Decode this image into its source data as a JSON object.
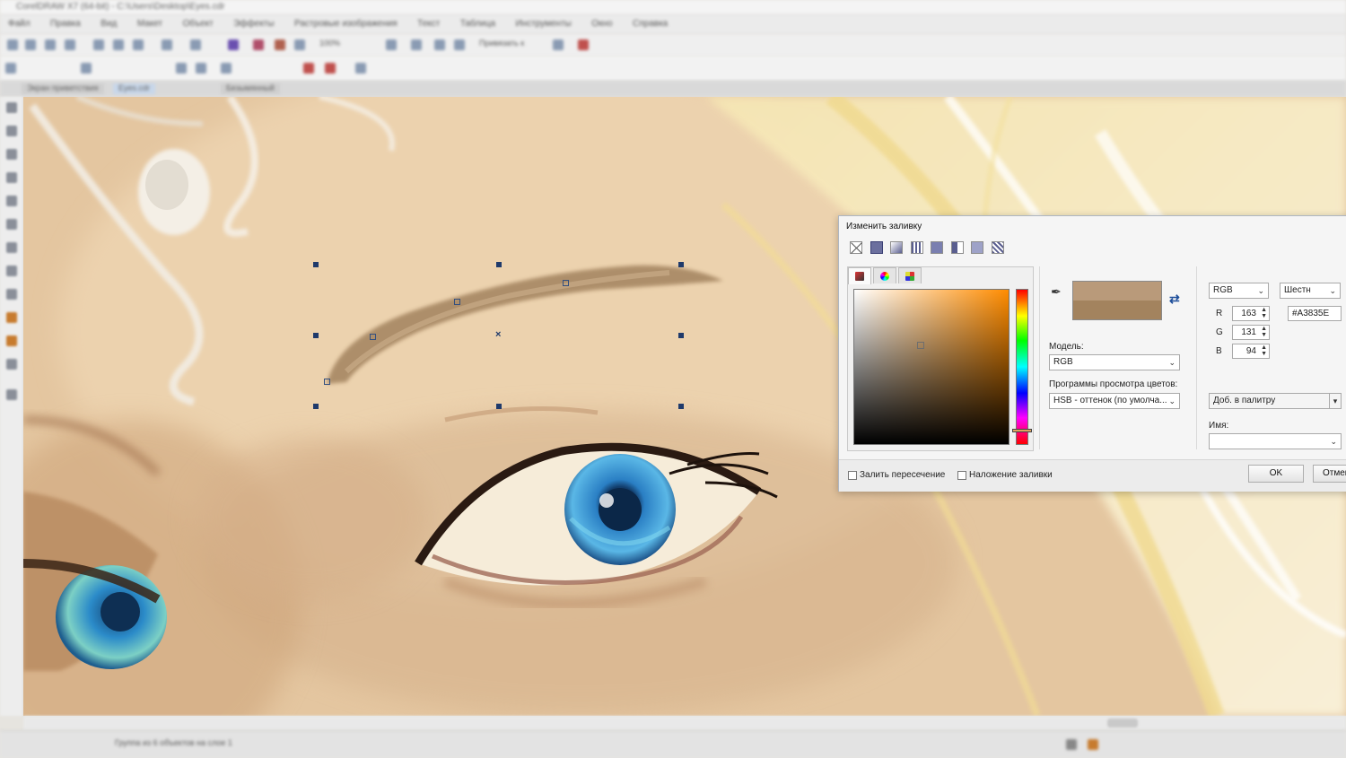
{
  "app": {
    "window_title": "CorelDRAW X7 (64-bit) - C:\\Users\\Desktop\\Eyes.cdr",
    "menu": [
      "Файл",
      "Правка",
      "Вид",
      "Макет",
      "Объект",
      "Эффекты",
      "Растровые изображения",
      "Текст",
      "Таблица",
      "Инструменты",
      "Окно",
      "Справка"
    ],
    "zoom": "100%",
    "snap_label": "Привязать к",
    "tabs": [
      "Экран приветствия",
      "Eyes.cdr",
      "Безымянный"
    ],
    "status_text": "Группа из 6 объектов на слое 1"
  },
  "canvas": {
    "colors": {
      "skin": "#e7c9a2",
      "brow": "#a3835e",
      "iris": "#2a7fc4",
      "hair": "#f3e2a8"
    }
  },
  "dialog": {
    "title": "Изменить заливку",
    "fill_types": [
      "no-fill",
      "uniform-fill",
      "fountain-fill",
      "vector-pattern-fill",
      "bitmap-pattern-fill",
      "two-color-fill",
      "texture-fill",
      "postscript-fill"
    ],
    "selected_fill_type": "uniform-fill",
    "picker_tabs": [
      "color-models-tab",
      "color-harmonies-tab",
      "color-palettes-tab"
    ],
    "color": {
      "current_top": "#b99a7a",
      "new_bottom": "#a3835e"
    },
    "model_label": "Модель:",
    "model_value": "RGB",
    "viewers_label": "Программы просмотра цветов:",
    "viewers_value": "HSB - оттенок (по умолча...",
    "color_model_select": "RGB",
    "hex_format_select": "Шестн",
    "channels": [
      {
        "name": "R",
        "value": "163"
      },
      {
        "name": "G",
        "value": "131"
      },
      {
        "name": "B",
        "value": "94"
      }
    ],
    "hex_value": "#A3835E",
    "add_to_palette": "Доб. в палитру",
    "name_label": "Имя:",
    "name_value": "",
    "checkbox_fill_intersection": "Залить пересечение",
    "checkbox_overprint_fill": "Наложение заливки",
    "ok_label": "OK",
    "cancel_label": "Отмена"
  }
}
